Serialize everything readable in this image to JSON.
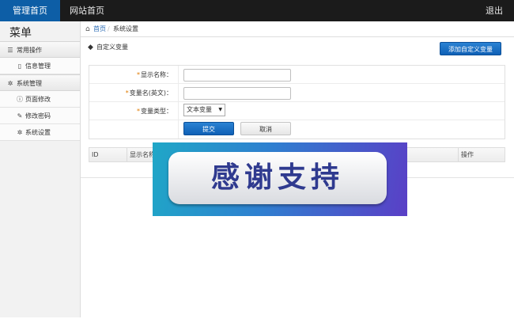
{
  "topbar": {
    "nav_home": "管理首页",
    "nav_site": "网站首页",
    "logout": "退出"
  },
  "sidebar": {
    "title": "菜单",
    "groups": [
      {
        "label": "常用操作",
        "icon": "list-icon",
        "items": [
          {
            "label": "信息管理",
            "icon": "document-icon"
          }
        ]
      },
      {
        "label": "系统管理",
        "icon": "gear-icon",
        "items": [
          {
            "label": "页面修改",
            "icon": "info-icon"
          },
          {
            "label": "修改密码",
            "icon": "wrench-icon"
          },
          {
            "label": "系统设置",
            "icon": "gear-icon"
          }
        ]
      }
    ]
  },
  "breadcrumb": {
    "home": "首页",
    "current": "系统设置"
  },
  "section": {
    "title": "自定义变量",
    "add_button": "添加自定义变量"
  },
  "form": {
    "display_name_label": "显示名称：",
    "var_name_label": "变量名(英文)：",
    "var_type_label": "变量类型：",
    "var_type_selected": "文本变量",
    "submit": "提交",
    "cancel": "取消"
  },
  "table": {
    "columns": [
      "ID",
      "显示名称",
      "操作"
    ]
  },
  "overlay": {
    "text": "感谢支持"
  },
  "colors": {
    "accent": "#0d5ea6",
    "topbar": "#1b1b1b",
    "required": "#e07b00"
  }
}
